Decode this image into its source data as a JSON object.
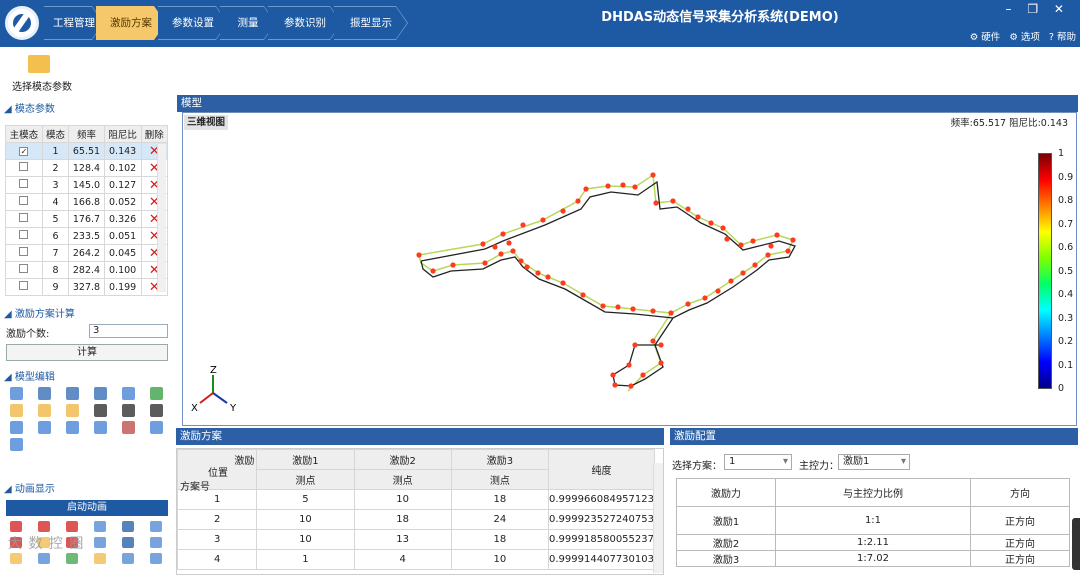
{
  "header": {
    "app_title": "DHDAS动态信号采集分析系统(DEMO)",
    "nav": [
      "工程管理",
      "激励方案",
      "参数设置",
      "测量",
      "参数识别",
      "振型显示"
    ],
    "active_nav": "激励方案",
    "window_controls": "– ❐ ✕",
    "tools": [
      "硬件",
      "选项",
      "帮助"
    ]
  },
  "left": {
    "select_button": "选择模态参数",
    "modal_section": "模态参数",
    "modal_cols": [
      "主模态",
      "模态",
      "频率",
      "阻尼比",
      "删除"
    ],
    "modal_rows": [
      {
        "checked": true,
        "mode": "1",
        "freq": "65.51",
        "damp": "0.143"
      },
      {
        "checked": false,
        "mode": "2",
        "freq": "128.4",
        "damp": "0.102"
      },
      {
        "checked": false,
        "mode": "3",
        "freq": "145.0",
        "damp": "0.127"
      },
      {
        "checked": false,
        "mode": "4",
        "freq": "166.8",
        "damp": "0.052"
      },
      {
        "checked": false,
        "mode": "5",
        "freq": "176.7",
        "damp": "0.326"
      },
      {
        "checked": false,
        "mode": "6",
        "freq": "233.5",
        "damp": "0.051"
      },
      {
        "checked": false,
        "mode": "7",
        "freq": "264.2",
        "damp": "0.045"
      },
      {
        "checked": false,
        "mode": "8",
        "freq": "282.4",
        "damp": "0.100"
      },
      {
        "checked": false,
        "mode": "9",
        "freq": "327.8",
        "damp": "0.199"
      }
    ],
    "calc_section": "激励方案计算",
    "exc_count_label": "激励个数:",
    "exc_count_value": "3",
    "calc_button": "计算",
    "edit_section": "模型编辑",
    "anim_section": "动画显示",
    "anim_button": "启动动画"
  },
  "model": {
    "title": "模型",
    "view_label": "三维视图",
    "freq_info": "频率:65.517 阻尼比:0.143",
    "axes": {
      "z": "Z",
      "x": "X",
      "y": "Y"
    },
    "colorbar_ticks": [
      "1",
      "0.9",
      "0.8",
      "0.7",
      "0.6",
      "0.5",
      "0.4",
      "0.3",
      "0.2",
      "0.1",
      "0"
    ]
  },
  "excitation": {
    "title": "激励方案",
    "header_corner": [
      "激励",
      "位置",
      "方案号"
    ],
    "header_cols": [
      "激励1",
      "激励2",
      "激励3"
    ],
    "sub_header": "测点",
    "purity_header": "纯度",
    "rows": [
      {
        "id": "1",
        "e1": "5",
        "e2": "10",
        "e3": "18",
        "purity": "0.999966084957123"
      },
      {
        "id": "2",
        "e1": "10",
        "e2": "18",
        "e3": "24",
        "purity": "0.999923527240753"
      },
      {
        "id": "3",
        "e1": "10",
        "e2": "13",
        "e3": "18",
        "purity": "0.999918580055237"
      },
      {
        "id": "4",
        "e1": "1",
        "e2": "4",
        "e3": "10",
        "purity": "0.999914407730103"
      }
    ]
  },
  "config": {
    "title": "激励配置",
    "scheme_label": "选择方案：",
    "scheme_value": "1",
    "main_label": "主控力：",
    "main_value": "激励1",
    "cols": [
      "激励力",
      "与主控力比例",
      "方向"
    ],
    "rows": [
      {
        "force": "激励1",
        "ratio": "1:1",
        "dir": "正方向"
      },
      {
        "force": "激励2",
        "ratio": "1:2.11",
        "dir": "正方向"
      },
      {
        "force": "激励3",
        "ratio": "1:7.02",
        "dir": "正方向"
      }
    ]
  },
  "watermark": "大 数 控 圈"
}
